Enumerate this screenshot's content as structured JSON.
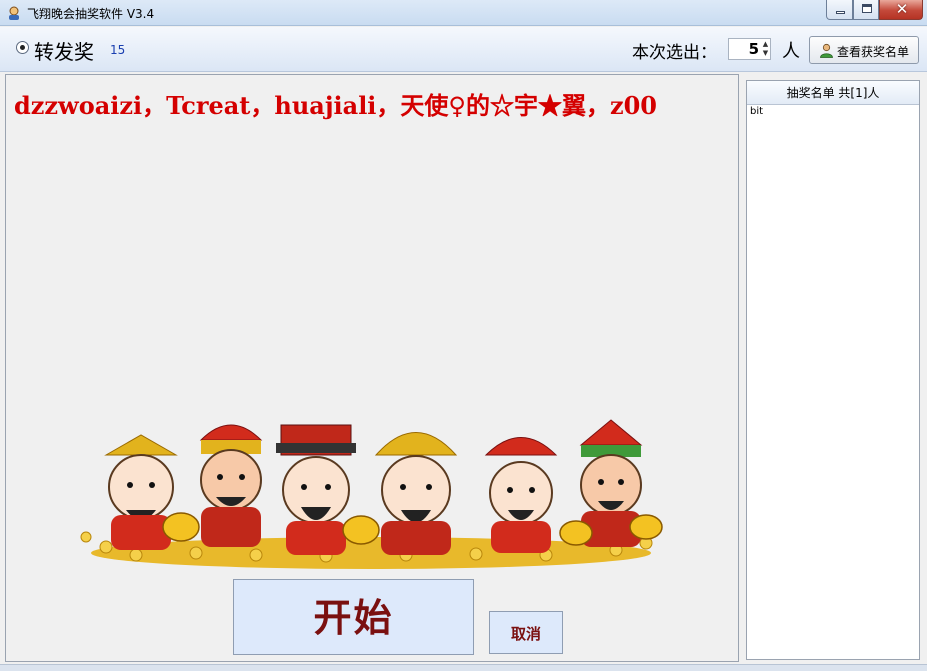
{
  "window": {
    "title": "飞翔晚会抽奖软件 V3.4",
    "close_glyph": "✕"
  },
  "toolbar": {
    "prize_name": "转发奖",
    "prize_count": "15",
    "pick_label": "本次选出：",
    "pick_value": "5",
    "unit_label": "人",
    "view_winners_label": "查看获奖名单",
    "spin_up": "▲",
    "spin_down": "▼"
  },
  "draw": {
    "winners_text": "dzzwoaizi，Tcreat，huajiali，天使♀的☆宇★翼，z00",
    "start_label": "开始",
    "cancel_label": "取消"
  },
  "list": {
    "header": "抽奖名单 共[1]人",
    "items": [
      "bit"
    ]
  },
  "icons": {
    "app": "app-icon",
    "user": "user-icon"
  },
  "colors": {
    "winners_text": "#d40000",
    "start_text": "#7a1010",
    "button_bg": "#dde9fb"
  }
}
